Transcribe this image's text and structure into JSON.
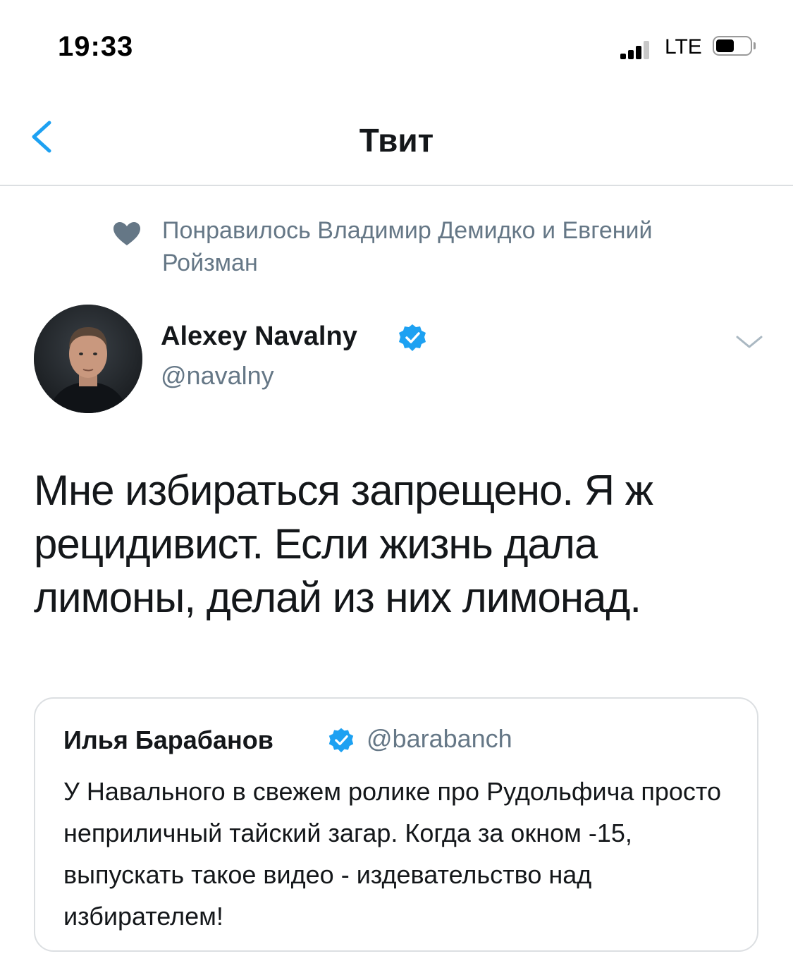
{
  "status_bar": {
    "time": "19:33",
    "network": "LTE",
    "signal_bars_filled": 3,
    "signal_bars_total": 4,
    "battery_level": 0.6
  },
  "nav": {
    "title": "Твит",
    "back_icon": "chevron-left-icon",
    "accent_color": "#1da1f2"
  },
  "context": {
    "icon": "heart-icon",
    "text": "Понравилось Владимир Демидко и Евгений Ройзман"
  },
  "tweet": {
    "author_name": "Alexey Navalny",
    "author_handle": "@navalny",
    "verified": true,
    "text": "Мне избираться запрещено. Я ж рецидивист. Если жизнь дала лимоны, делай из них лимонад."
  },
  "quote": {
    "author_name": "Илья Барабанов",
    "author_handle": "@barabanch",
    "verified": true,
    "text": "У Навального в свежем ролике про Рудольфича просто неприличный тайский загар. Когда за окном -15, выпускать такое видео - издевательство над избирателем!"
  }
}
